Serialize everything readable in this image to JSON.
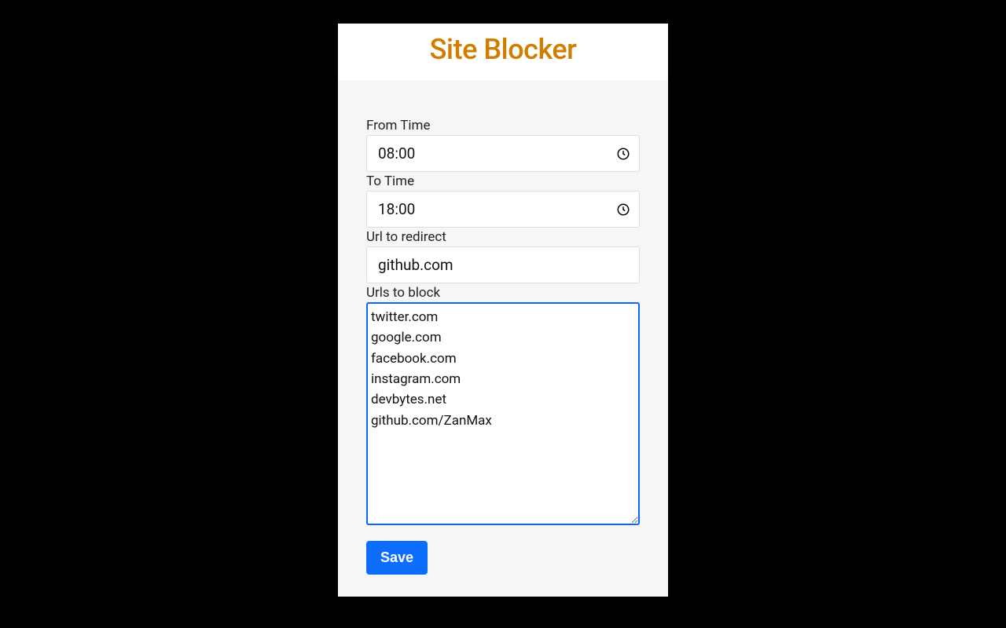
{
  "header": {
    "title": "Site Blocker"
  },
  "form": {
    "from_time": {
      "label": "From Time",
      "value": "08:00"
    },
    "to_time": {
      "label": "To Time",
      "value": "18:00"
    },
    "redirect_url": {
      "label": "Url to redirect",
      "value": "github.com"
    },
    "block_urls": {
      "label": "Urls to block",
      "value": "twitter.com\ngoogle.com\nfacebook.com\ninstagram.com\ndevbytes.net\ngithub.com/ZanMax"
    },
    "save_label": "Save"
  },
  "colors": {
    "accent": "#d17e00",
    "primary": "#0d6efd",
    "focus_border": "#0a66ff"
  }
}
